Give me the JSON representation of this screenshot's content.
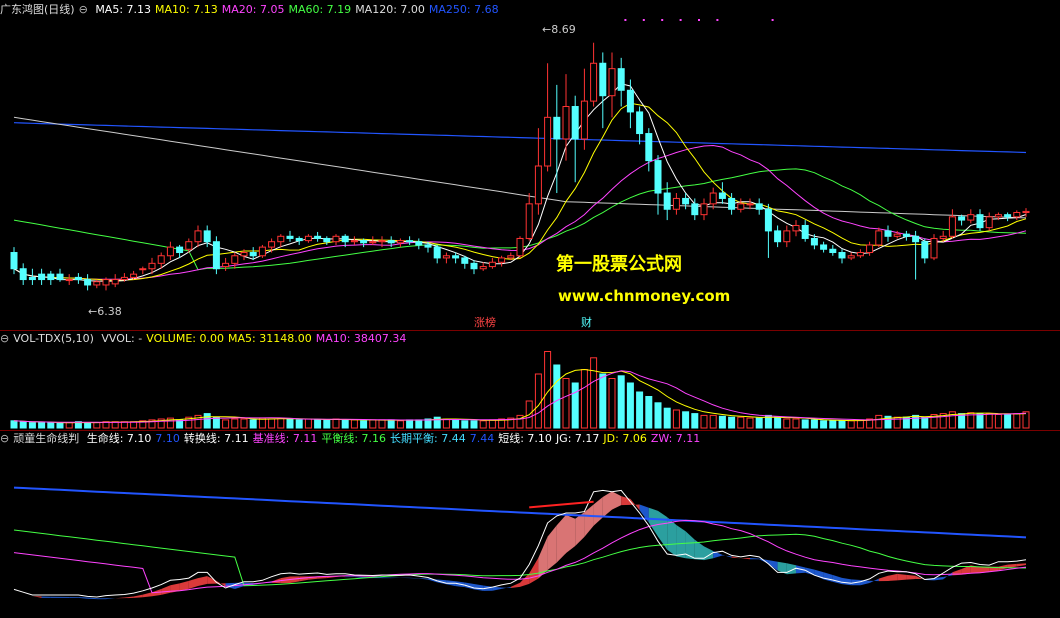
{
  "header_main": {
    "title": "广东鸿图(日线)",
    "items": [
      {
        "label": "MA5: 7.13",
        "color": "#ffffff"
      },
      {
        "label": "MA10: 7.13",
        "color": "#ffff00"
      },
      {
        "label": "MA20: 7.05",
        "color": "#ff44ff"
      },
      {
        "label": "MA60: 7.19",
        "color": "#44ff44"
      },
      {
        "label": "MA120: 7.00",
        "color": "#dddddd"
      },
      {
        "label": "MA250: 7.68",
        "color": "#2255ff"
      }
    ]
  },
  "header_vol": {
    "title": "VOL-TDX(5,10)",
    "items": [
      {
        "label": "VVOL: -",
        "color": "#dddddd"
      },
      {
        "label": "VOLUME: 0.00",
        "color": "#ffff00"
      },
      {
        "label": "MA5: 31148.00",
        "color": "#ffff00"
      },
      {
        "label": "MA10: 38407.34",
        "color": "#ff44ff"
      }
    ]
  },
  "header_ind": {
    "title": "顽童生命线判",
    "items": [
      {
        "label": "生命线: 7.10",
        "color": "#ffffff"
      },
      {
        "label": "7.10",
        "color": "#2255ff"
      },
      {
        "label": "转换线: 7.11",
        "color": "#ffffff"
      },
      {
        "label": "基准线: 7.11",
        "color": "#ff44ff"
      },
      {
        "label": "平衡线: 7.16",
        "color": "#44ff44"
      },
      {
        "label": "长期平衡: 7.44",
        "color": "#44ddff"
      },
      {
        "label": "7.44",
        "color": "#2255ff"
      },
      {
        "label": "短线: 7.10",
        "color": "#ffffff"
      },
      {
        "label": "JG: 7.17",
        "color": "#ffffff"
      },
      {
        "label": "JD: 7.06",
        "color": "#ffff00"
      },
      {
        "label": "ZW: 7.11",
        "color": "#ff44ff"
      }
    ]
  },
  "watermark": {
    "line1": "第一股票公式网",
    "line2": "www.chnmoney.com"
  },
  "tags": {
    "zhangting": "涨榜",
    "cai": "财"
  },
  "annotations": {
    "high": "8.69",
    "low": "6.38"
  },
  "colors": {
    "up": "#ff3333",
    "down": "#54ffff",
    "sep": "#7a0000"
  },
  "chart_data": [
    {
      "type": "candlestick",
      "ylim": [
        6.2,
        8.9
      ],
      "high_label": 8.69,
      "low_label": 6.38,
      "candles": [
        [
          6.75,
          6.6,
          6.8,
          6.55
        ],
        [
          6.6,
          6.5,
          6.65,
          6.45
        ],
        [
          6.52,
          6.5,
          6.6,
          6.45
        ],
        [
          6.55,
          6.5,
          6.6,
          6.45
        ],
        [
          6.55,
          6.5,
          6.58,
          6.45
        ],
        [
          6.55,
          6.5,
          6.6,
          6.48
        ],
        [
          6.5,
          6.5,
          6.55,
          6.45
        ],
        [
          6.52,
          6.5,
          6.56,
          6.46
        ],
        [
          6.5,
          6.45,
          6.55,
          6.4
        ],
        [
          6.45,
          6.48,
          6.5,
          6.42
        ],
        [
          6.45,
          6.5,
          6.52,
          6.4
        ],
        [
          6.46,
          6.5,
          6.55,
          6.43
        ],
        [
          6.5,
          6.52,
          6.56,
          6.48
        ],
        [
          6.52,
          6.55,
          6.58,
          6.5
        ],
        [
          6.6,
          6.6,
          6.62,
          6.55
        ],
        [
          6.6,
          6.65,
          6.7,
          6.55
        ],
        [
          6.65,
          6.72,
          6.75,
          6.6
        ],
        [
          6.72,
          6.8,
          6.85,
          6.68
        ],
        [
          6.8,
          6.75,
          6.82,
          6.7
        ],
        [
          6.78,
          6.85,
          6.88,
          6.75
        ],
        [
          6.85,
          6.95,
          7.0,
          6.8
        ],
        [
          6.95,
          6.85,
          7.0,
          6.8
        ],
        [
          6.85,
          6.6,
          6.9,
          6.55
        ],
        [
          6.62,
          6.65,
          6.7,
          6.58
        ],
        [
          6.65,
          6.72,
          6.75,
          6.6
        ],
        [
          6.72,
          6.75,
          6.78,
          6.68
        ],
        [
          6.75,
          6.72,
          6.8,
          6.68
        ],
        [
          6.72,
          6.8,
          6.82,
          6.7
        ],
        [
          6.8,
          6.85,
          6.88,
          6.75
        ],
        [
          6.85,
          6.9,
          6.92,
          6.8
        ],
        [
          6.9,
          6.88,
          6.95,
          6.85
        ],
        [
          6.88,
          6.86,
          6.9,
          6.82
        ],
        [
          6.86,
          6.9,
          6.92,
          6.84
        ],
        [
          6.9,
          6.88,
          6.94,
          6.85
        ],
        [
          6.88,
          6.85,
          6.9,
          6.82
        ],
        [
          6.85,
          6.9,
          6.92,
          6.82
        ],
        [
          6.9,
          6.85,
          6.92,
          6.8
        ],
        [
          6.85,
          6.86,
          6.9,
          6.82
        ],
        [
          6.86,
          6.84,
          6.88,
          6.8
        ],
        [
          6.84,
          6.85,
          6.9,
          6.82
        ],
        [
          6.85,
          6.86,
          6.9,
          6.8
        ],
        [
          6.86,
          6.84,
          6.9,
          6.8
        ],
        [
          6.84,
          6.86,
          6.88,
          6.8
        ],
        [
          6.86,
          6.85,
          6.9,
          6.82
        ],
        [
          6.85,
          6.82,
          6.88,
          6.78
        ],
        [
          6.82,
          6.8,
          6.85,
          6.75
        ],
        [
          6.8,
          6.7,
          6.82,
          6.65
        ],
        [
          6.7,
          6.72,
          6.75,
          6.65
        ],
        [
          6.72,
          6.7,
          6.75,
          6.65
        ],
        [
          6.7,
          6.65,
          6.72,
          6.6
        ],
        [
          6.65,
          6.6,
          6.68,
          6.55
        ],
        [
          6.6,
          6.62,
          6.66,
          6.58
        ],
        [
          6.62,
          6.66,
          6.7,
          6.6
        ],
        [
          6.66,
          6.7,
          6.72,
          6.62
        ],
        [
          6.7,
          6.72,
          6.75,
          6.68
        ],
        [
          6.72,
          6.88,
          6.9,
          6.7
        ],
        [
          6.88,
          7.2,
          7.3,
          6.86
        ],
        [
          7.2,
          7.55,
          7.9,
          7.1
        ],
        [
          7.55,
          8.0,
          8.5,
          7.5
        ],
        [
          8.0,
          7.8,
          8.3,
          7.3
        ],
        [
          7.8,
          8.1,
          8.4,
          7.6
        ],
        [
          8.1,
          7.8,
          8.2,
          7.4
        ],
        [
          7.8,
          8.15,
          8.45,
          7.7
        ],
        [
          8.15,
          8.5,
          8.69,
          8.1
        ],
        [
          8.5,
          8.2,
          8.6,
          7.9
        ],
        [
          8.2,
          8.45,
          8.6,
          8.0
        ],
        [
          8.45,
          8.25,
          8.55,
          8.1
        ],
        [
          8.25,
          8.05,
          8.35,
          7.9
        ],
        [
          8.05,
          7.85,
          8.1,
          7.75
        ],
        [
          7.85,
          7.6,
          7.9,
          7.5
        ],
        [
          7.6,
          7.3,
          7.65,
          7.1
        ],
        [
          7.3,
          7.15,
          7.4,
          7.05
        ],
        [
          7.15,
          7.25,
          7.3,
          7.1
        ],
        [
          7.25,
          7.2,
          7.3,
          7.15
        ],
        [
          7.2,
          7.1,
          7.25,
          7.05
        ],
        [
          7.1,
          7.2,
          7.25,
          7.05
        ],
        [
          7.2,
          7.3,
          7.35,
          7.15
        ],
        [
          7.3,
          7.25,
          7.4,
          7.2
        ],
        [
          7.25,
          7.15,
          7.3,
          7.1
        ],
        [
          7.15,
          7.2,
          7.25,
          7.12
        ],
        [
          7.2,
          7.2,
          7.25,
          7.15
        ],
        [
          7.2,
          7.15,
          7.25,
          7.1
        ],
        [
          7.15,
          6.95,
          7.2,
          6.7
        ],
        [
          6.95,
          6.85,
          7.0,
          6.8
        ],
        [
          6.85,
          6.95,
          7.0,
          6.8
        ],
        [
          6.95,
          7.0,
          7.05,
          6.9
        ],
        [
          7.0,
          6.88,
          7.05,
          6.85
        ],
        [
          6.88,
          6.82,
          6.92,
          6.78
        ],
        [
          6.82,
          6.78,
          6.85,
          6.75
        ],
        [
          6.78,
          6.75,
          6.82,
          6.72
        ],
        [
          6.75,
          6.7,
          6.78,
          6.65
        ],
        [
          6.7,
          6.72,
          6.75,
          6.68
        ],
        [
          6.72,
          6.75,
          6.78,
          6.7
        ],
        [
          6.75,
          6.82,
          6.85,
          6.72
        ],
        [
          6.82,
          6.95,
          6.98,
          6.8
        ],
        [
          6.95,
          6.9,
          7.0,
          6.85
        ],
        [
          6.9,
          6.92,
          6.95,
          6.88
        ],
        [
          6.92,
          6.9,
          6.95,
          6.86
        ],
        [
          6.9,
          6.85,
          6.95,
          6.5
        ],
        [
          6.85,
          6.7,
          6.88,
          6.65
        ],
        [
          6.7,
          6.88,
          6.92,
          6.68
        ],
        [
          6.88,
          6.9,
          6.95,
          6.85
        ],
        [
          6.9,
          7.08,
          7.15,
          6.88
        ],
        [
          7.08,
          7.05,
          7.1,
          7.0
        ],
        [
          7.05,
          7.1,
          7.15,
          7.02
        ],
        [
          7.1,
          6.98,
          7.15,
          6.95
        ],
        [
          6.98,
          7.08,
          7.12,
          6.95
        ],
        [
          7.08,
          7.1,
          7.12,
          7.05
        ],
        [
          7.1,
          7.08,
          7.12,
          7.04
        ],
        [
          7.08,
          7.12,
          7.14,
          7.05
        ],
        [
          7.12,
          7.13,
          7.16,
          7.08
        ]
      ]
    },
    {
      "type": "bar",
      "ylim": [
        0,
        90
      ],
      "values": [
        8,
        7,
        6,
        6,
        6,
        5,
        6,
        7,
        6,
        6,
        7,
        7,
        7,
        7,
        8,
        9,
        10,
        11,
        9,
        12,
        14,
        16,
        12,
        9,
        10,
        10,
        9,
        11,
        10,
        11,
        10,
        9,
        10,
        9,
        9,
        10,
        9,
        9,
        8,
        9,
        9,
        9,
        8,
        9,
        9,
        10,
        12,
        10,
        9,
        8,
        8,
        8,
        9,
        10,
        11,
        14,
        30,
        60,
        85,
        70,
        55,
        50,
        65,
        78,
        60,
        55,
        58,
        50,
        40,
        35,
        28,
        22,
        20,
        18,
        16,
        14,
        14,
        13,
        12,
        12,
        11,
        11,
        14,
        12,
        10,
        10,
        9,
        9,
        8,
        8,
        8,
        8,
        9,
        10,
        14,
        13,
        12,
        12,
        14,
        12,
        15,
        16,
        18,
        16,
        17,
        16,
        16,
        15,
        15,
        16,
        18
      ]
    },
    {
      "type": "line",
      "ylim": [
        6.1,
        9.0
      ],
      "series_colors": [
        "#2255ff",
        "#44ff44",
        "#ff44ff",
        "#ffffff"
      ]
    }
  ]
}
